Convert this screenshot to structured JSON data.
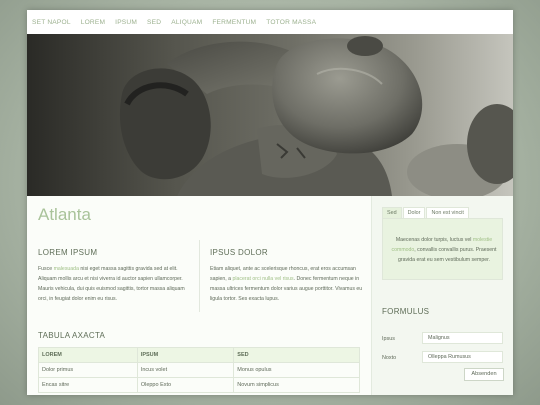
{
  "nav": {
    "items": [
      "SET NAPOL",
      "LOREM",
      "IPSUM",
      "SED",
      "ALIQUAM",
      "FERMENTUM",
      "TOTOR MASSA"
    ]
  },
  "hero": {
    "image": "man-carrying-boulder-photo"
  },
  "main": {
    "title": "Atlanta",
    "col1": {
      "heading": "LOREM IPSUM",
      "text_a": "Fusce ",
      "link": "malesuada",
      "text_b": " nisi eget massa sagittis gravida sed at elit. Aliquam mollis arcu et nisi viverra id auctor sapien ullamcorper. Mauris vehicula, dui quis euismod sagittis, tortor massa aliquam orci, in feugiat dolor enim eu risus."
    },
    "col2": {
      "heading": "IPSUS DOLOR",
      "text_a": "Etiam aliquet, ante ac scelerisque rhoncus, erat eros accumsan sapien, a ",
      "link": "placerat orci nulla vel risus",
      "text_b": ". Donec fermentum neque in massa ultrices fermentum dolor varius augue porttitor. Vivamus eu ligula tortor. Ses exacta lupus."
    },
    "table": {
      "title": "TABULA AXACTA",
      "headers": [
        "LOREM",
        "IPSUM",
        "SED"
      ],
      "rows": [
        [
          "Dolor primus",
          "Incus volet",
          "Monus opulus"
        ],
        [
          "Encas sitre",
          "Oleppo Exto",
          "Novum simplicus"
        ]
      ]
    }
  },
  "sidebar": {
    "tabs": [
      "Sed",
      "Dolor",
      "Non est vincit"
    ],
    "active_tab": "Sed",
    "tab_text_a": "Maecenas dolor turpis, luctus vel ",
    "tab_link": "molestie commodo",
    "tab_text_b": ", convallis convallis purus. Praesent gravida erat eu sem vestibulum semper.",
    "form": {
      "title": "FORMULUS",
      "fields": [
        {
          "label": "Ipsus",
          "value": "Malignus"
        },
        {
          "label": "Noxto",
          "value": "Olleppa Rumusus"
        }
      ],
      "submit_label": "Absenden"
    }
  },
  "colors": {
    "accent": "#a9c39a",
    "link": "#9fbf85",
    "background": "#a8b4a4"
  }
}
